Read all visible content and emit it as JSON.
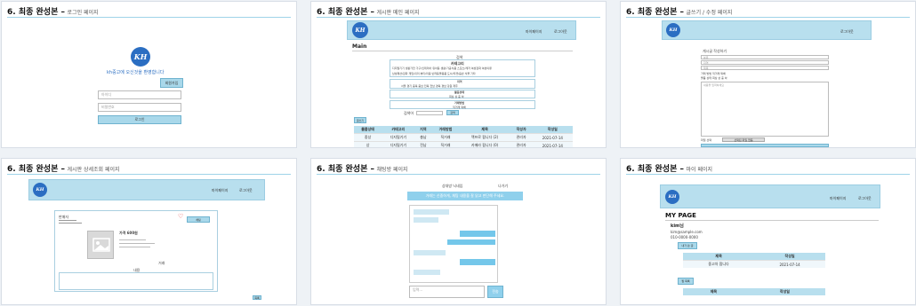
{
  "cards": [
    {
      "num": "6. 최종 완성본 –",
      "sub": "로그인 페이지"
    },
    {
      "num": "6. 최종 완성본 –",
      "sub": "게시판 메인 페이지"
    },
    {
      "num": "6. 최종 완성본 –",
      "sub": "글쓰기 / 수정 페이지"
    },
    {
      "num": "6. 최종 완성본 –",
      "sub": "게시판 상세조회 페이지"
    },
    {
      "num": "6. 최종 완성본 –",
      "sub": "채팅방 페이지"
    },
    {
      "num": "6. 최종 완성본 –",
      "sub": "마이 페이지"
    }
  ],
  "logo_text": "KH",
  "login": {
    "welcome": "kh중고에 오신것을 환영합니다",
    "join": "회원가입",
    "id_placeholder": "아이디",
    "pw_placeholder": "비밀번호",
    "login_button": "로그인"
  },
  "main": {
    "nav1": "마이페이지",
    "nav2": "로그아웃",
    "title": "Main",
    "filter_label": "검색",
    "category_label": "카테고리",
    "category_line1": "디지털기기 생활가전 가구/인테리어 유아동 생활/가공식품 스포츠/레저 여성잡화 여성의류",
    "category_line2": "남성패션/잡화 게임/취미 뷰티/미용 반려동물용품 도서/티켓/음반 식물 기타",
    "region_label": "지역",
    "region_line": "서울 경기 충북 충남 전북 전남 경북 경남 강원 제주",
    "status_label": "물품상태",
    "status_line": "최상 상 중 하",
    "deal_label": "거래방법",
    "deal_line": "직거래 택배",
    "search_label": "검색어",
    "search_button": "검색",
    "write_button": "글쓰기",
    "headers": [
      "물품상태",
      "카테고리",
      "지역",
      "거래방법",
      "제목",
      "작성자",
      "작성일"
    ],
    "rows": [
      [
        "중상",
        "디지털기기",
        "충남",
        "직거래",
        "맥프로 팝니다 (2)",
        "관리자",
        "2021-07-14"
      ],
      [
        "상",
        "디지털기기",
        "전남",
        "직거래",
        "카메라 팝니다 (0)",
        "관리자",
        "2021-07-14"
      ]
    ]
  },
  "write": {
    "nav": "로그아웃",
    "heading": "게시글 작성하기",
    "select1": "분류",
    "select2": "지역",
    "title_placeholder": "제목",
    "hint1": "거래 방법 직거래 택배",
    "hint2": "물품 상태 최상 상 중 하",
    "content_placeholder": "내용을 입력하세요",
    "file_label": "파일 선택",
    "file_none": "선택된 파일 없음",
    "submit": "등록"
  },
  "detail": {
    "nav1": "마이페이지",
    "nav2": "로그아웃",
    "seller": "판매자",
    "price": "가격 600원",
    "chat_button": "채팅",
    "deal": "거래",
    "info_label": "내용",
    "list_button": "목록"
  },
  "chat": {
    "header": "상대방 닉네임",
    "out": "나가기",
    "notice": "거래는 신중하게, 채팅 내용을 잘 읽고 판단해 주세요.",
    "input_placeholder": "입력...",
    "send": "전송"
  },
  "mypage": {
    "nav1": "마이페이지",
    "nav2": "로그아웃",
    "title": "MY PAGE",
    "name": "kim님",
    "email": "kim@sample.com",
    "phone": "010-0000-0000",
    "section1": "내가 쓴 글",
    "table1_headers": [
      "제목",
      "작성일"
    ],
    "table1_row": [
      "중고차 팝니다",
      "2021-07-14"
    ],
    "section2": "찜 목록",
    "table2_headers": [
      "제목",
      "작성일"
    ]
  }
}
